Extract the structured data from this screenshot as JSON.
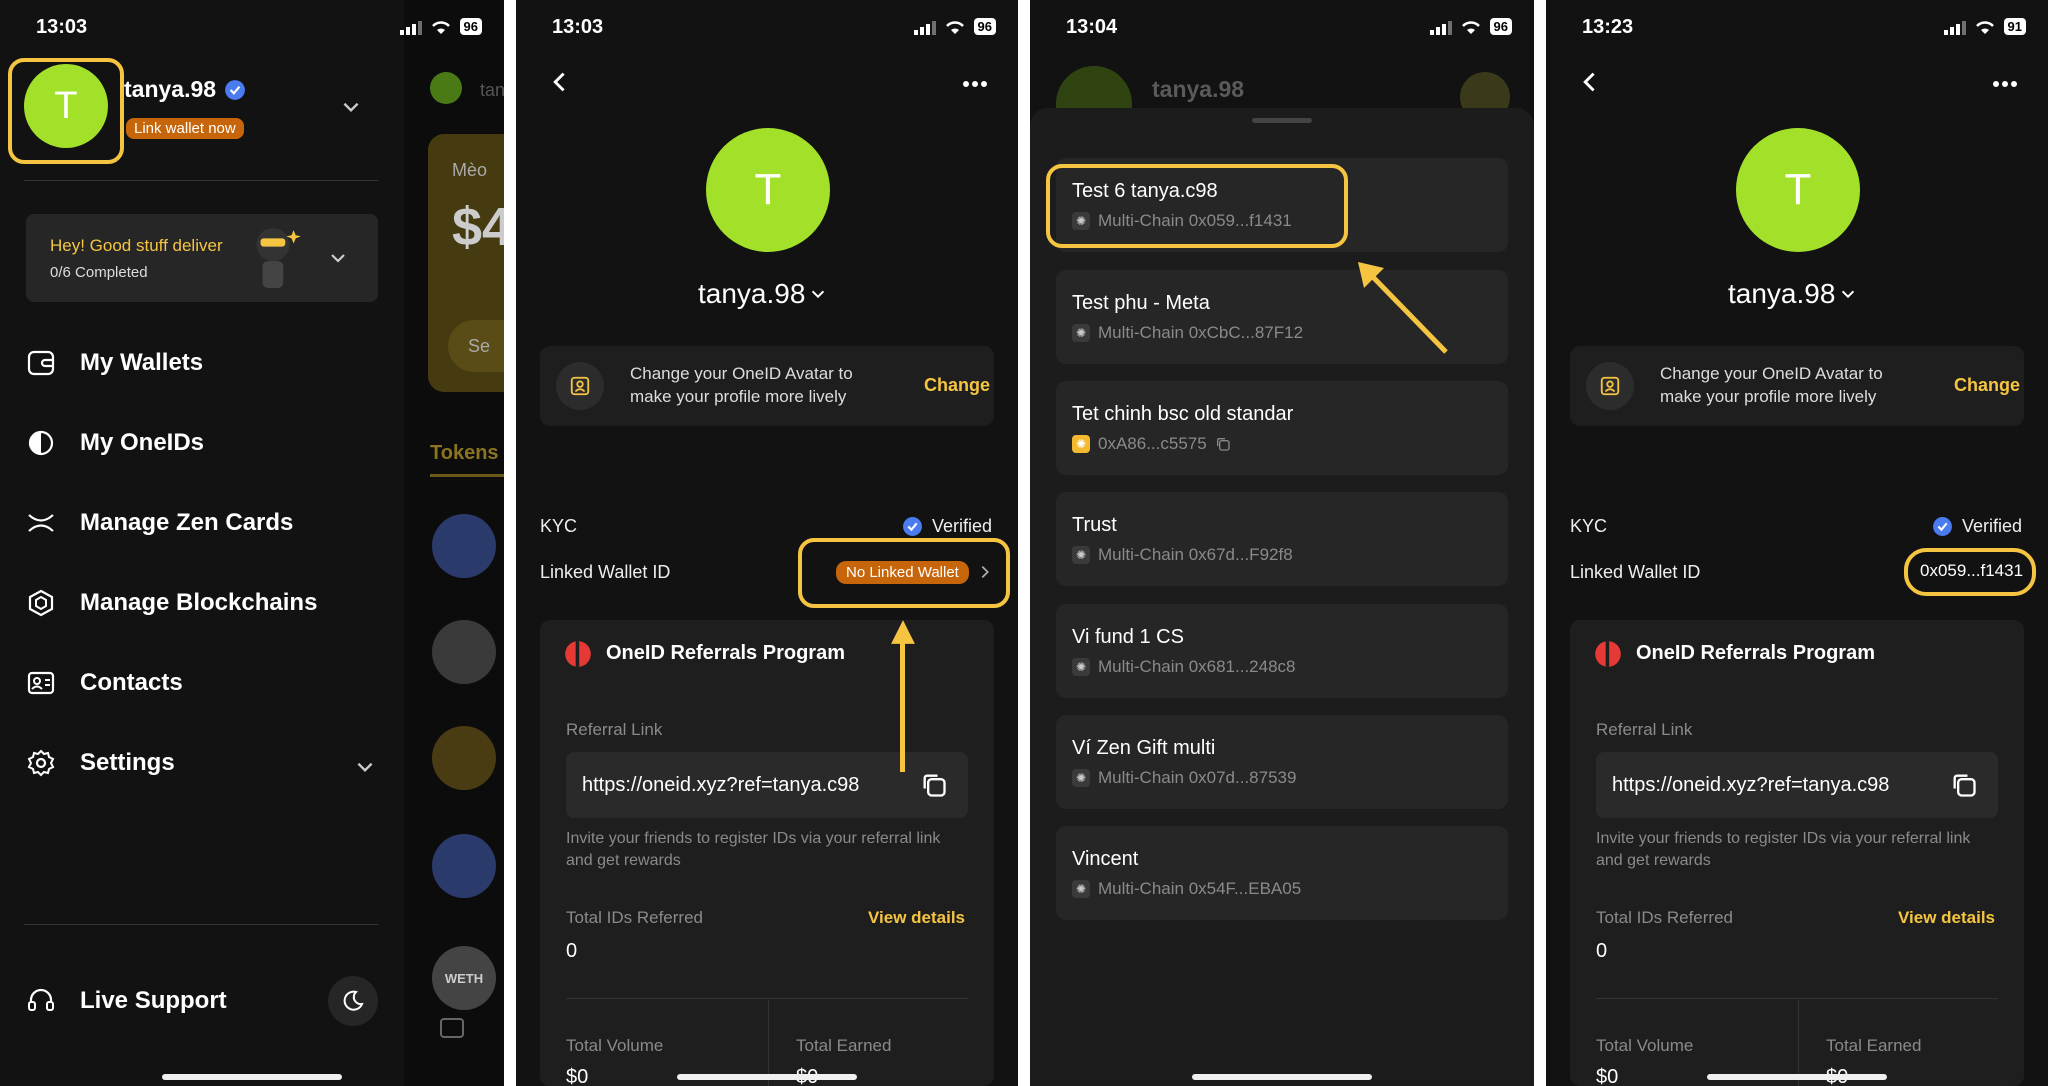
{
  "screens": [
    {
      "time": "13:03",
      "battery": "96",
      "user": {
        "avatar_letter": "T",
        "name": "tanya.98",
        "link_badge": "Link wallet now"
      },
      "quest": {
        "title": "Hey! Good stuff deliver",
        "progress": "0/6 Completed"
      },
      "menu": [
        "My Wallets",
        "My OneIDs",
        "Manage Zen Cards",
        "Manage Blockchains",
        "Contacts",
        "Settings"
      ],
      "footer": {
        "support": "Live Support"
      },
      "background": {
        "header_partial": "tan",
        "card_partial": "Mèo",
        "amount_partial": "$4",
        "button_partial": "Se",
        "tab_partial": "Tokens",
        "token_label": "WETH"
      }
    },
    {
      "time": "13:03",
      "battery": "96",
      "avatar_letter": "T",
      "name": "tanya.98",
      "avatar_tip": "Change your OneID Avatar to make your profile more lively",
      "change_label": "Change",
      "kyc_label": "KYC",
      "kyc_status": "Verified",
      "linked_label": "Linked Wallet ID",
      "linked_value": "No Linked Wallet",
      "referral": {
        "title": "OneID Referrals Program",
        "link_label": "Referral Link",
        "link": "https://oneid.xyz?ref=tanya.c98",
        "invite": "Invite your friends to register IDs via your referral link and get rewards",
        "total_ids_label": "Total IDs Referred",
        "view_details": "View details",
        "total_ids": "0",
        "volume_label": "Total Volume",
        "volume": "$0",
        "earned_label": "Total Earned",
        "earned": "$0"
      }
    },
    {
      "time": "13:04",
      "battery": "96",
      "behind_name": "tanya.98",
      "wallets": [
        {
          "name": "Test 6 tanya.c98",
          "sub": "Multi-Chain 0x059...f1431"
        },
        {
          "name": "Test phu - Meta",
          "sub": "Multi-Chain 0xCbC...87F12"
        },
        {
          "name": "Tet chinh bsc old standar",
          "sub": "0xA86...c5575"
        },
        {
          "name": "Trust",
          "sub": "Multi-Chain 0x67d...F92f8"
        },
        {
          "name": "Vi fund 1 CS",
          "sub": "Multi-Chain 0x681...248c8"
        },
        {
          "name": "Ví Zen Gift multi",
          "sub": "Multi-Chain 0x07d...87539"
        },
        {
          "name": "Vincent",
          "sub": "Multi-Chain 0x54F...EBA05"
        }
      ]
    },
    {
      "time": "13:23",
      "battery": "91",
      "avatar_letter": "T",
      "name": "tanya.98",
      "avatar_tip": "Change your OneID Avatar to make your profile more lively",
      "change_label": "Change",
      "kyc_label": "KYC",
      "kyc_status": "Verified",
      "linked_label": "Linked Wallet ID",
      "linked_value": "0x059...f1431",
      "referral": {
        "title": "OneID Referrals Program",
        "link_label": "Referral Link",
        "link": "https://oneid.xyz?ref=tanya.c98",
        "invite": "Invite your friends to register IDs via your referral link and get rewards",
        "total_ids_label": "Total IDs Referred",
        "view_details": "View details",
        "total_ids": "0",
        "volume_label": "Total Volume",
        "volume": "$0",
        "earned_label": "Total Earned",
        "earned": "$0"
      }
    }
  ],
  "colors": {
    "accent": "#f5c542",
    "avatar": "#a3e02a",
    "badge": "#c7650a",
    "verified": "#4a7cf0",
    "background": "#121212"
  }
}
